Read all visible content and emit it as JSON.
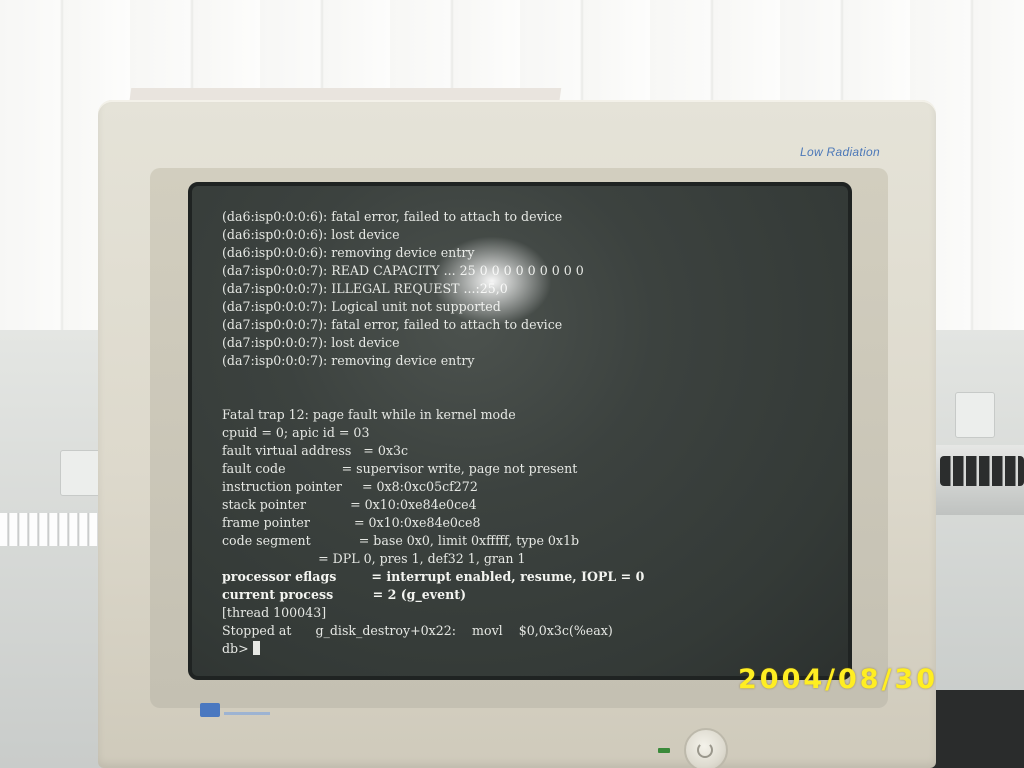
{
  "photo": {
    "monitor_label": "Low Radiation",
    "date_stamp": "2004/08/30"
  },
  "terminal": {
    "lines": [
      "(da6:isp0:0:0:6): fatal error, failed to attach to device",
      "(da6:isp0:0:0:6): lost device",
      "(da6:isp0:0:0:6): removing device entry",
      "(da7:isp0:0:0:7): READ CAPACITY ... 25 0 0 0 0 0 0 0 0 0",
      "(da7:isp0:0:0:7): ILLEGAL REQUEST ...:25,0",
      "(da7:isp0:0:0:7): Logical unit not supported",
      "(da7:isp0:0:0:7): fatal error, failed to attach to device",
      "(da7:isp0:0:0:7): lost device",
      "(da7:isp0:0:0:7): removing device entry",
      "",
      "",
      "Fatal trap 12: page fault while in kernel mode",
      "cpuid = 0; apic id = 03",
      "fault virtual address   = 0x3c",
      "fault code              = supervisor write, page not present",
      "instruction pointer     = 0x8:0xc05cf272",
      "stack pointer           = 0x10:0xe84e0ce4",
      "frame pointer           = 0x10:0xe84e0ce8",
      "code segment            = base 0x0, limit 0xfffff, type 0x1b",
      "                        = DPL 0, pres 1, def32 1, gran 1",
      "processor eflags        = interrupt enabled, resume, IOPL = 0",
      "current process         = 2 (g_event)",
      "[thread 100043]",
      "Stopped at      g_disk_destroy+0x22:    movl    $0,0x3c(%eax)"
    ],
    "bold_lines": [
      20,
      21
    ],
    "prompt": "db>"
  }
}
